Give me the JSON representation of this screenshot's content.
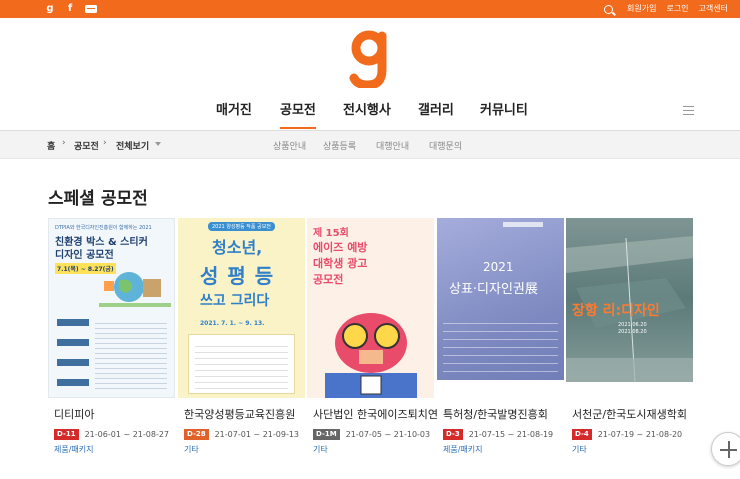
{
  "topbar": {
    "social_icons": [
      "g-logo-icon",
      "facebook-icon",
      "kakao-icon"
    ],
    "g_glyph": "g",
    "f_glyph": "f",
    "kakao_glyph": "talk",
    "util": {
      "signup": "회원가입",
      "login": "로그인",
      "help": "고객센터"
    }
  },
  "brand": {
    "accent": "#f26b1d"
  },
  "nav": {
    "items": [
      "매거진",
      "공모전",
      "전시행사",
      "갤러리",
      "커뮤니티"
    ],
    "active": "공모전"
  },
  "breadcrumb": {
    "home": "홈",
    "level1": "공모전",
    "level2": "전체보기"
  },
  "subnav": [
    "상품안내",
    "상품등록",
    "대행안내",
    "대행문의"
  ],
  "section_title": "스페셜 공모전",
  "cards": [
    {
      "org": "디티피아",
      "dday": "D-11",
      "dday_color": "#d42a2a",
      "period": "21-06-01 ~ 21-08-27",
      "category": "제품/패키지",
      "poster": {
        "bg": "#f2f7fb",
        "t1": "DTPIA와 한국디자인진흥원이 함께하는 2021",
        "t2": "친환경 박스 & 스티커",
        "t3": "디자인 공모전",
        "t4": "7.1(목) ~ 8.27(금)"
      }
    },
    {
      "org": "한국양성평등교육진흥원",
      "dday": "D-28",
      "dday_color": "#e0622a",
      "period": "21-07-01 ~ 21-09-13",
      "category": "기타",
      "poster": {
        "bg": "#fbf3c8",
        "t1": "2021 양성평등 작품 공모전",
        "t2": "청소년,",
        "t3": "성 평 등",
        "t4": "쓰고 그리다",
        "t5": "2021. 7. 1. ~ 9. 13."
      }
    },
    {
      "org": "사단법인 한국에이즈퇴치연맹",
      "dday": "D-1M",
      "dday_color": "#666666",
      "period": "21-07-05 ~ 21-10-03",
      "category": "기타",
      "poster": {
        "bg": "#fdf0e6",
        "t1": "제 15회",
        "t2": "에이즈 예방",
        "t3": "대학생 광고",
        "t4": "공모전"
      }
    },
    {
      "org": "특허청/한국발명진흥회",
      "dday": "D-3",
      "dday_color": "#d42a2a",
      "period": "21-07-15 ~ 21-08-19",
      "category": "제품/패키지",
      "poster": {
        "bg": "#8a96c8",
        "t1": "2021",
        "t2": "상표·디자인권展"
      }
    },
    {
      "org": "서천군/한국도시재생학회",
      "dday": "D-4",
      "dday_color": "#d42a2a",
      "period": "21-07-19 ~ 21-08-20",
      "category": "기타",
      "poster": {
        "bg": "#5b7a78",
        "t1": "장항 리:디자인",
        "t2": "2021.06.20",
        "t3": "2021.08.20"
      }
    }
  ]
}
